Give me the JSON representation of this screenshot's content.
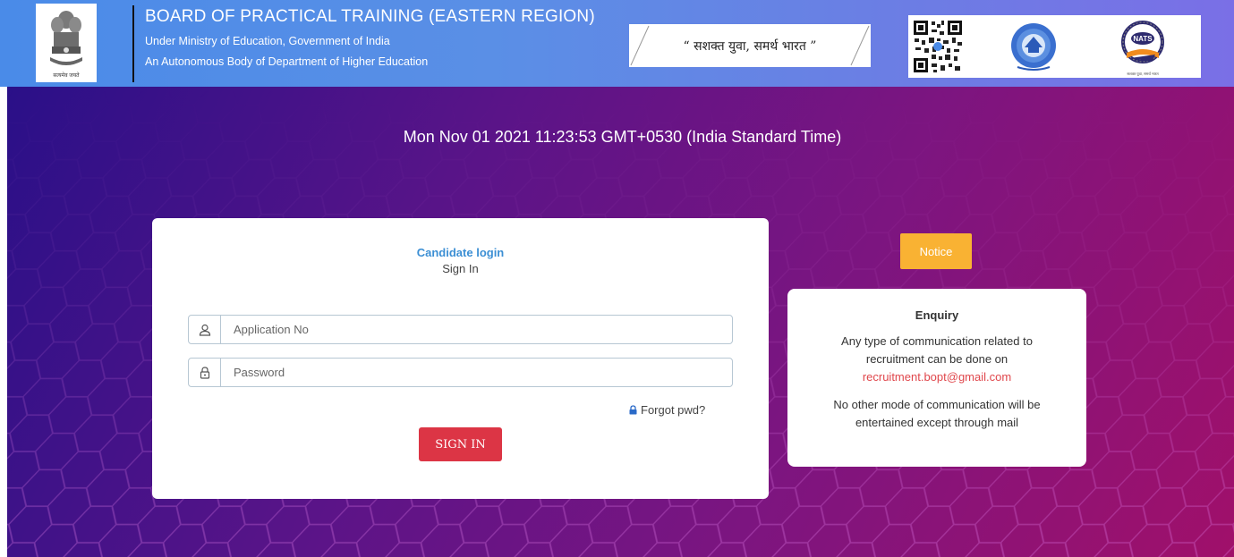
{
  "header": {
    "emblem_motto": "सत्यमेव जयते",
    "org_title": "BOARD OF PRACTICAL TRAINING (EASTERN REGION)",
    "org_line1": "Under Ministry of Education, Government of India",
    "org_line2": "An Autonomous Body of Department of Higher Education",
    "tagline": "“ सशक्त युवा, समर्थ भारत ”",
    "logo_icons": [
      "qr-code-icon",
      "round-seal-icon",
      "nats-logo-icon"
    ]
  },
  "main": {
    "datetime": "Mon Nov 01 2021 11:23:53 GMT+0530 (India Standard Time)"
  },
  "login": {
    "title": "Candidate login",
    "subtitle": "Sign In",
    "application_placeholder": "Application No",
    "application_value": "",
    "password_placeholder": "Password",
    "password_value": "",
    "forgot_label": "Forgot pwd?",
    "signin_label": "SIGN IN",
    "icons": [
      "user-icon",
      "lock-icon"
    ]
  },
  "notice": {
    "label": "Notice"
  },
  "enquiry": {
    "heading": "Enquiry",
    "line1": "Any type of communication related to",
    "line2": "recruitment can be done on",
    "email": "recruitment.bopt@gmail.com",
    "line3": "No other mode of communication will be",
    "line4": "entertained except through mail"
  },
  "colors": {
    "header_gradient_start": "#4a8be8",
    "main_gradient_start": "#2a1088",
    "main_gradient_end": "#a0106a",
    "accent_link": "#3c8fd4",
    "signin_button": "#dc3545",
    "notice_button": "#f9b233",
    "email_text": "#e0474c"
  }
}
